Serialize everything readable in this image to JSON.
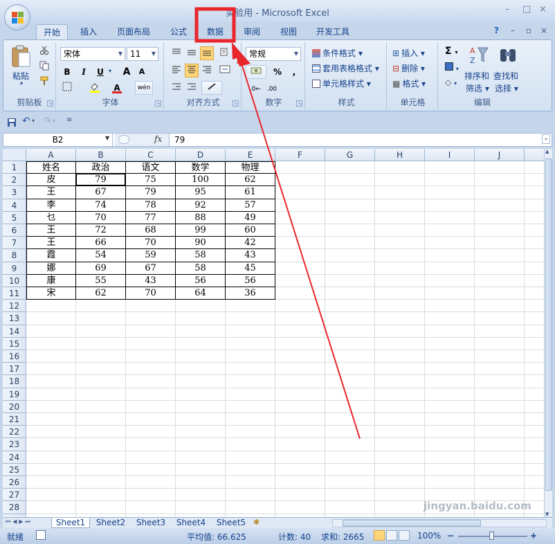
{
  "window": {
    "title": "实验用 - Microsoft Excel",
    "controls": [
      "–",
      "□",
      "×"
    ]
  },
  "tabs": [
    "开始",
    "插入",
    "页面布局",
    "公式",
    "数据",
    "审阅",
    "视图",
    "开发工具"
  ],
  "active_tab": "开始",
  "highlighted_tab": "数据",
  "ribbon": {
    "clipboard": {
      "paste": "粘贴",
      "label": "剪贴板"
    },
    "font": {
      "name": "宋体",
      "size": "11",
      "bold": "B",
      "italic": "I",
      "underline": "U",
      "grow": "A",
      "shrink": "A",
      "color_letter": "A",
      "wen": "wén",
      "label": "字体"
    },
    "alignment": {
      "label": "对齐方式"
    },
    "number": {
      "format": "常规",
      "percent": "%",
      "comma": ",",
      "label": "数字"
    },
    "styles": {
      "conditional": "条件格式",
      "table": "套用表格格式",
      "cell": "单元格样式",
      "label": "样式"
    },
    "cells": {
      "insert": "插入",
      "delete": "删除",
      "format": "格式",
      "label": "单元格"
    },
    "editing": {
      "sigma": "Σ",
      "sort": "排序和",
      "sort2": "筛选",
      "find": "查找和",
      "find2": "选择",
      "label": "编辑"
    }
  },
  "formula_bar": {
    "name_box": "B2",
    "fx": "fx",
    "value": "79"
  },
  "columns": [
    "A",
    "B",
    "C",
    "D",
    "E",
    "F",
    "G",
    "H",
    "I",
    "J"
  ],
  "rows": [
    "1",
    "2",
    "3",
    "4",
    "5",
    "6",
    "7",
    "8",
    "9",
    "10",
    "11",
    "12",
    "13",
    "14",
    "15",
    "16",
    "17",
    "18",
    "19",
    "20",
    "21",
    "22",
    "23",
    "24",
    "25",
    "26",
    "27",
    "28",
    "29"
  ],
  "table": {
    "header": [
      "姓名",
      "政治",
      "语文",
      "数学",
      "物理"
    ],
    "rows": [
      [
        "皮",
        "79",
        "75",
        "100",
        "62"
      ],
      [
        "王",
        "67",
        "79",
        "95",
        "61"
      ],
      [
        "李",
        "74",
        "78",
        "92",
        "57"
      ],
      [
        "乜",
        "70",
        "77",
        "88",
        "49"
      ],
      [
        "王",
        "72",
        "68",
        "99",
        "60"
      ],
      [
        "王",
        "66",
        "70",
        "90",
        "42"
      ],
      [
        "霞",
        "54",
        "59",
        "58",
        "43"
      ],
      [
        "娜",
        "69",
        "67",
        "58",
        "45"
      ],
      [
        "康",
        "55",
        "43",
        "56",
        "56"
      ],
      [
        "宋",
        "62",
        "70",
        "64",
        "36"
      ]
    ]
  },
  "sheets": [
    "Sheet1",
    "Sheet2",
    "Sheet3",
    "Sheet4",
    "Sheet5"
  ],
  "active_sheet": "Sheet1",
  "status": {
    "ready": "就绪",
    "average": "平均值: 66.625",
    "count": "计数: 40",
    "sum": "求和: 2665",
    "zoom": "100%",
    "minus": "−",
    "plus": "+"
  },
  "watermark": "jingyan.baidu.com",
  "colors": {
    "annotation": "#e8262b",
    "ribbon": "#dfe9f6",
    "header": "#dde7f4"
  }
}
